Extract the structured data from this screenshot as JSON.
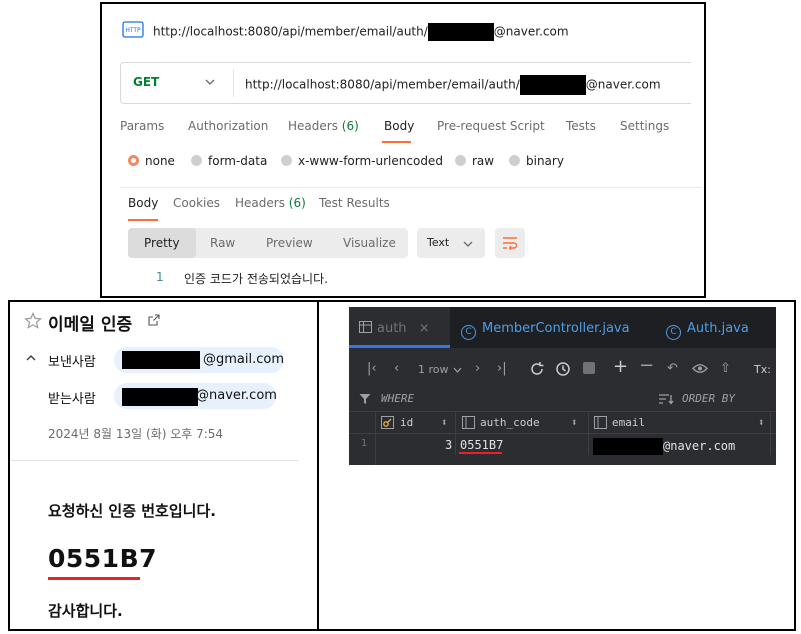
{
  "postman": {
    "title_prefix": "http://localhost:8080/api/member/email/auth/",
    "title_suffix": "@naver.com",
    "method": "GET",
    "url_prefix": "http://localhost:8080/api/member/email/auth/",
    "url_suffix": "@naver.com",
    "request_tabs": [
      "Params",
      "Authorization",
      "Headers",
      "Body",
      "Pre-request Script",
      "Tests",
      "Settings"
    ],
    "headers_count": "(6)",
    "body_types": [
      "none",
      "form-data",
      "x-www-form-urlencoded",
      "raw",
      "binary"
    ],
    "response_tabs": [
      "Body",
      "Cookies",
      "Headers",
      "Test Results"
    ],
    "response_headers_count": "(6)",
    "view_modes": [
      "Pretty",
      "Raw",
      "Preview",
      "Visualize"
    ],
    "format": "Text",
    "line_number": "1",
    "response_text": "인증 코드가 전송되었습니다."
  },
  "email": {
    "subject": "이메일 인증",
    "from_label": "보낸사람",
    "from_suffix": "@gmail.com",
    "to_label": "받는사람",
    "to_suffix": "@naver.com",
    "date": "2024년 8월 13일 (화) 오후 7:54",
    "body_line1": "요청하신 인증 번호입니다.",
    "code": "0551B7",
    "body_line2": "감사합니다."
  },
  "db": {
    "tabs": [
      "auth",
      "MemberController.java",
      "Auth.java"
    ],
    "row_count": "1 row",
    "tx_label": "Tx:",
    "where_label": "WHERE",
    "order_label": "ORDER BY",
    "columns": [
      "id",
      "auth_code",
      "email"
    ],
    "rows": [
      {
        "rownum": "1",
        "id": "3",
        "auth_code": "0551B7",
        "email_suffix": "@naver.com"
      }
    ]
  },
  "colors": {
    "postman_accent": "#ff6c37",
    "get_method": "#007f31",
    "highlight_red": "#e8212b",
    "ide_bg": "#2b2d30",
    "ide_tab_accent": "#3574f0"
  }
}
